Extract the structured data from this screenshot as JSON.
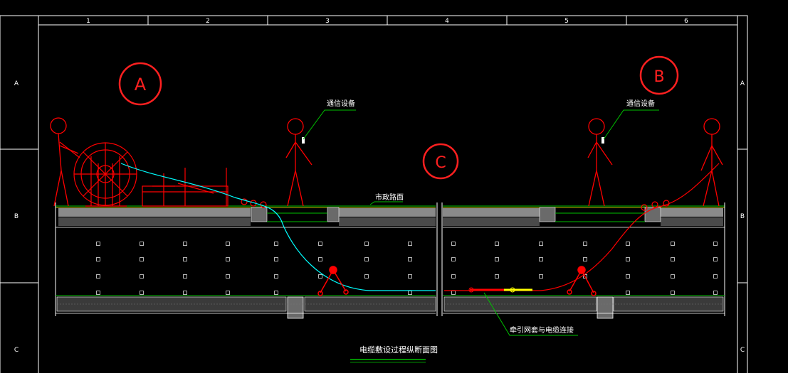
{
  "colors": {
    "background": "#000000",
    "frame": "#ffffff",
    "red": "#ff0000",
    "green": "#00c000",
    "cyan": "#00ffff",
    "yellow": "#ffff00",
    "gray": "#8a8a8a",
    "dark_gray": "#4a4a4a"
  },
  "grid": {
    "columns": [
      "1",
      "2",
      "3",
      "4",
      "5",
      "6"
    ],
    "rows": [
      "A",
      "B",
      "C"
    ]
  },
  "markers": {
    "a": "A",
    "b": "B",
    "c": "C"
  },
  "labels": {
    "comm_left": "通信设备",
    "comm_right": "通信设备",
    "road_surface": "市政路面",
    "traction_net": "牵引网套与电缆连接",
    "drawing_title": "电缆敷设过程纵断面图"
  },
  "icons": {
    "person": "stick-figure-icon",
    "cable_drum": "cable-drum-icon",
    "pulley": "pulley-icon"
  }
}
